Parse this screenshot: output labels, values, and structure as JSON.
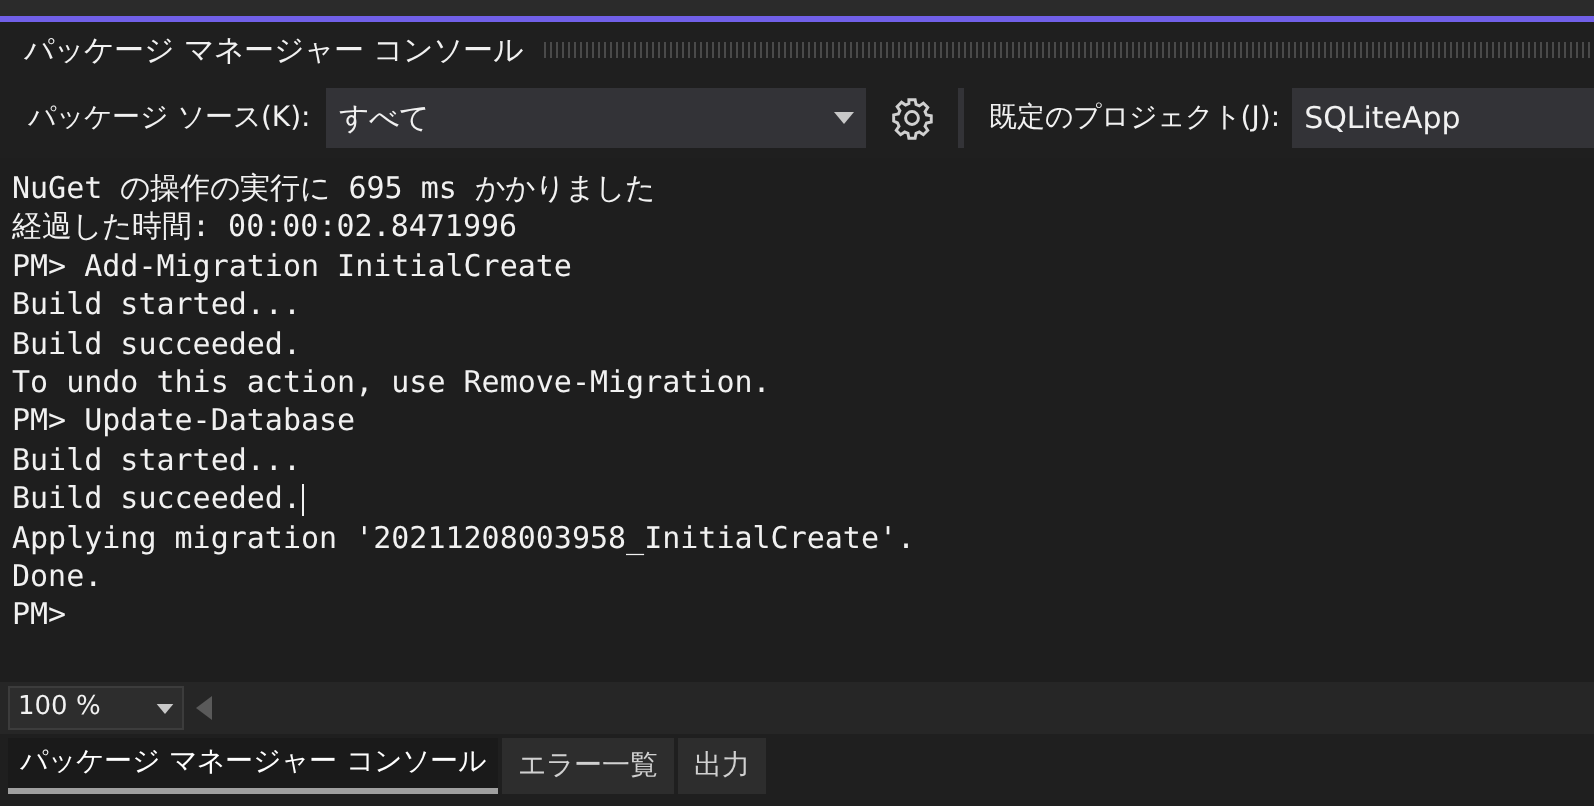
{
  "panel": {
    "title": "パッケージ マネージャー コンソール"
  },
  "toolbar": {
    "source_label": "パッケージ ソース(K):",
    "source_value": "すべて",
    "project_label": "既定のプロジェクト(J):",
    "project_value": "SQLiteApp"
  },
  "console": {
    "lines": [
      {
        "text": "NuGet の操作の実行に 695 ms かかりました",
        "cursor": false
      },
      {
        "text": "経過した時間: 00:00:02.8471996",
        "cursor": false
      },
      {
        "text": "PM> Add-Migration InitialCreate",
        "cursor": false
      },
      {
        "text": "Build started...",
        "cursor": false
      },
      {
        "text": "Build succeeded.",
        "cursor": false
      },
      {
        "text": "To undo this action, use Remove-Migration.",
        "cursor": false
      },
      {
        "text": "PM> Update-Database",
        "cursor": false
      },
      {
        "text": "Build started...",
        "cursor": false
      },
      {
        "text": "Build succeeded.",
        "cursor": true
      },
      {
        "text": "Applying migration '20211208003958_InitialCreate'.",
        "cursor": false
      },
      {
        "text": "Done.",
        "cursor": false
      },
      {
        "text": "PM>",
        "cursor": false
      }
    ]
  },
  "zoom": {
    "value": "100 %"
  },
  "tabs": [
    {
      "label": "パッケージ マネージャー コンソール",
      "selected": true
    },
    {
      "label": "エラー一覧",
      "selected": false
    },
    {
      "label": "出力",
      "selected": false
    }
  ]
}
